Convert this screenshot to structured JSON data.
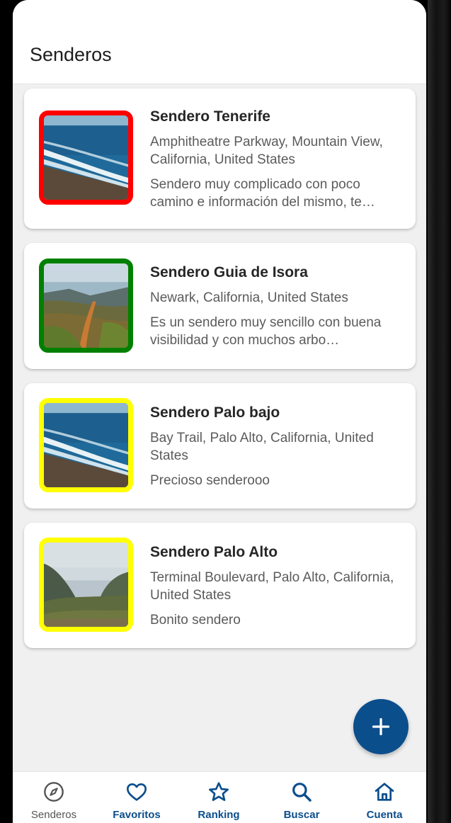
{
  "colors": {
    "accent": "#0b4e8c",
    "difficulty_red": "#ff0000",
    "difficulty_green": "#008000",
    "difficulty_yellow": "#ffff00"
  },
  "header": {
    "title": "Senderos"
  },
  "trails": [
    {
      "title": "Sendero Tenerife",
      "address": "Amphitheatre Parkway, Mountain View, California, United States",
      "description": "Sendero muy complicado con poco camino e información del mismo, te…",
      "border_color": "#ff0000",
      "image_icon": "ocean-coast-image"
    },
    {
      "title": "Sendero Guia de Isora",
      "address": "Newark, California, United States",
      "description": "Es un sendero muy sencillo con buena visibilidad y con muchos arbo…",
      "border_color": "#008000",
      "image_icon": "mountain-path-image"
    },
    {
      "title": "Sendero Palo bajo",
      "address": "Bay Trail, Palo Alto, California, United States",
      "description": "Precioso senderooo",
      "border_color": "#ffff00",
      "image_icon": "ocean-coast-image"
    },
    {
      "title": "Sendero Palo Alto",
      "address": "Terminal Boulevard, Palo Alto, California, United States",
      "description": "Bonito sendero",
      "border_color": "#ffff00",
      "image_icon": "valley-view-image"
    }
  ],
  "fab": {
    "icon": "plus-icon"
  },
  "bottom_nav": [
    {
      "label": "Senderos",
      "icon": "compass-icon",
      "active": false
    },
    {
      "label": "Favoritos",
      "icon": "heart-icon",
      "active": true
    },
    {
      "label": "Ranking",
      "icon": "star-icon",
      "active": true
    },
    {
      "label": "Buscar",
      "icon": "search-icon",
      "active": true
    },
    {
      "label": "Cuenta",
      "icon": "home-icon",
      "active": true
    }
  ]
}
